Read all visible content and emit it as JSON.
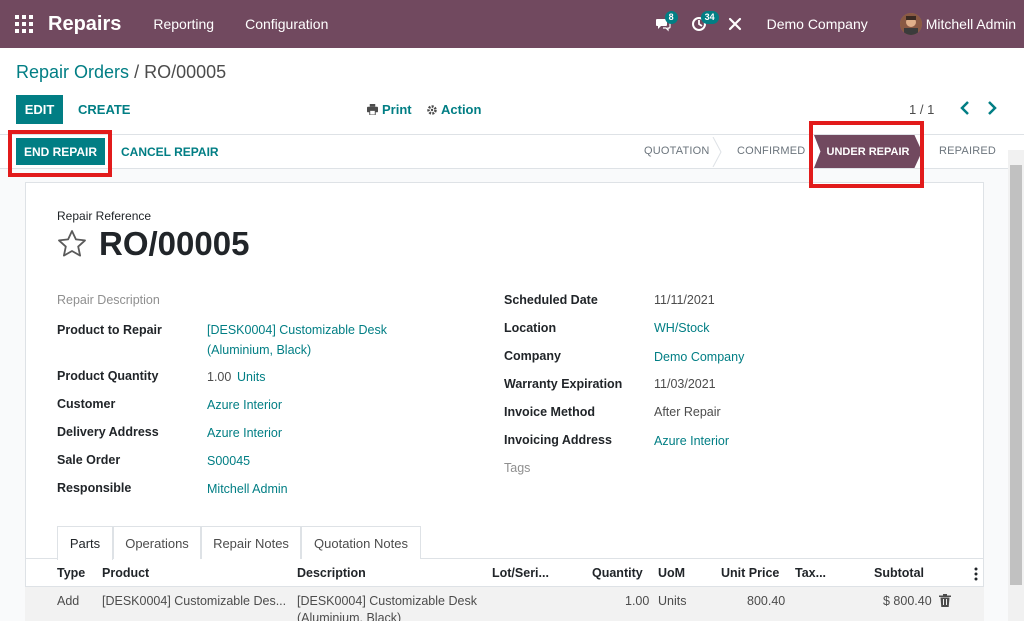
{
  "navbar": {
    "brand": "Repairs",
    "menus": [
      "Reporting",
      "Configuration"
    ],
    "messages_count": "8",
    "activities_count": "34",
    "company": "Demo Company",
    "user": "Mitchell Admin",
    "bg_color": "#71495f"
  },
  "breadcrumb": {
    "parent": "Repair Orders",
    "separator": "/",
    "current": "RO/00005"
  },
  "toolbar": {
    "edit": "EDIT",
    "create": "CREATE",
    "print": "Print",
    "action": "Action",
    "pager": "1 / 1"
  },
  "statusbar": {
    "end_repair": "END REPAIR",
    "cancel_repair": "CANCEL REPAIR",
    "stages": [
      "QUOTATION",
      "CONFIRMED",
      "UNDER REPAIR",
      "REPAIRED"
    ],
    "active_stage": "UNDER REPAIR"
  },
  "form": {
    "reference_label": "Repair Reference",
    "reference": "RO/00005",
    "repair_description_placeholder": "Repair Description",
    "left": {
      "product_label": "Product to Repair",
      "product_line1": "[DESK0004] Customizable Desk",
      "product_line2": "(Aluminium, Black)",
      "quantity_label": "Product Quantity",
      "quantity": "1.00",
      "quantity_uom": "Units",
      "customer_label": "Customer",
      "customer": "Azure Interior",
      "delivery_label": "Delivery Address",
      "delivery": "Azure Interior",
      "sale_order_label": "Sale Order",
      "sale_order": "S00045",
      "responsible_label": "Responsible",
      "responsible": "Mitchell Admin"
    },
    "right": {
      "scheduled_label": "Scheduled Date",
      "scheduled": "11/11/2021",
      "location_label": "Location",
      "location": "WH/Stock",
      "company_label": "Company",
      "company": "Demo Company",
      "warranty_label": "Warranty Expiration",
      "warranty": "11/03/2021",
      "invoice_method_label": "Invoice Method",
      "invoice_method": "After Repair",
      "invoicing_address_label": "Invoicing Address",
      "invoicing_address": "Azure Interior",
      "tags_placeholder": "Tags"
    }
  },
  "tabs": [
    "Parts",
    "Operations",
    "Repair Notes",
    "Quotation Notes"
  ],
  "table": {
    "headers": [
      "Type",
      "Product",
      "Description",
      "Lot/Seri...",
      "Quantity",
      "UoM",
      "Unit Price",
      "Tax...",
      "Subtotal"
    ],
    "rows": [
      {
        "type": "Add",
        "product": "[DESK0004] Customizable Des...",
        "description_line1": "[DESK0004] Customizable Desk",
        "description_line2": "(Aluminium, Black)",
        "lot": "",
        "quantity": "1.00",
        "uom": "Units",
        "unit_price": "800.40",
        "taxes": "",
        "subtotal": "$ 800.40"
      }
    ]
  },
  "colors": {
    "primary": "#017e84",
    "brand": "#71495f",
    "highlight": "#e21b1b"
  }
}
